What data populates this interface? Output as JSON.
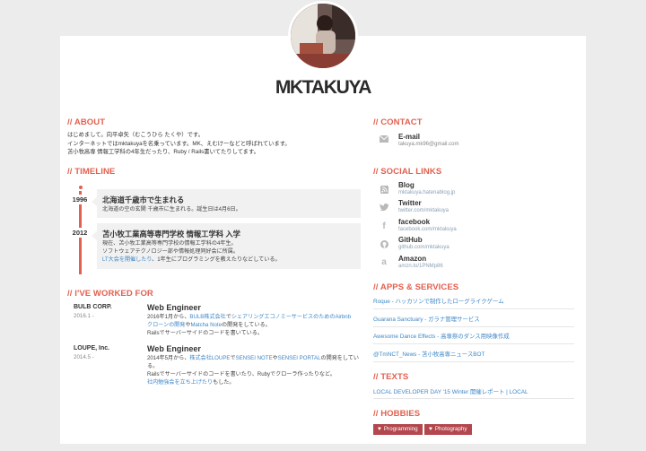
{
  "profile": {
    "name": "MKTAKUYA"
  },
  "about": {
    "title": "// ABOUT",
    "lines": [
      "はじめまして。向平卓矢（むこうひら たくや）です。",
      "インターネットではmktakuyaを名乗っています。MK、えむけーなどと呼ばれています。",
      "苫小牧高専 情報工学科の4年生だったり、Ruby / Rails書いてたりしてます。"
    ]
  },
  "timeline": {
    "title": "// TIMELINE",
    "items": [
      {
        "year": "1996",
        "heading": "北海道千歳市で生まれる",
        "lines": [
          "北海道の空の玄関 千歳市に生まれる。誕生日は4月6日。"
        ]
      },
      {
        "year": "2012",
        "heading": "苫小牧工業高等専門学校 情報工学科 入学",
        "lines": [
          "現在、苫小牧工業高等専門学校の情報工学科の4年生。",
          "ソフトウェアテクノロジー部や情報処理同好会に所属。"
        ],
        "link_text": "LT大会を開催したり",
        "after_link": "、1年生にプログラミングを教えたりなどしている。"
      }
    ]
  },
  "work": {
    "title": "// I'VE WORKED FOR",
    "items": [
      {
        "company": "BULB CORP.",
        "period": "2016.1 -",
        "position": "Web Engineer",
        "line1_pre": "2016年1月から、",
        "line1_link1": "BULB株式会社",
        "line1_mid": "で",
        "line1_link2": "シェアリングエコノミーサービスのためのAirbnb",
        "line2_link1": "クローンの開発",
        "line2_mid": "や",
        "line2_link2": "Matcha Note",
        "line2_post": "の開発をしている。",
        "line3": "Railsでサーバーサイドのコードを書いている。"
      },
      {
        "company": "LOUPE, Inc.",
        "period": "2014.5 -",
        "position": "Web Engineer",
        "line1_pre": "2014年5月から、",
        "line1_link1": "株式会社LOUPE",
        "line1_mid": "で",
        "line1_link2": "SENSEI NOTE",
        "line1_mid2": "や",
        "line1_link3": "SENSEI PORTAL",
        "line1_post": "の開発をしてい",
        "line2": "る。",
        "line3": "Railsでサーバーサイドのコードを書いたり、Rubyでクローラ作ったりなど。",
        "line4_link": "社内勉強会を立ち上げたり",
        "line4_post": "もした。"
      }
    ]
  },
  "contact": {
    "title": "// CONTACT",
    "email_label": "E-mail",
    "email": "takuya.mk96@gmail.com"
  },
  "social": {
    "title": "// SOCIAL LINKS",
    "items": [
      {
        "icon": "rss-icon",
        "name": "Blog",
        "url": "mktakuya.hatenablog.jp"
      },
      {
        "icon": "twitter-icon",
        "name": "Twitter",
        "url": "twitter.com/mktakuya"
      },
      {
        "icon": "facebook-icon",
        "name": "facebook",
        "url": "facebook.com/mktakuya"
      },
      {
        "icon": "github-icon",
        "name": "GitHub",
        "url": "github.com/mktakuya"
      },
      {
        "icon": "amazon-icon",
        "name": "Amazon",
        "url": "amzn.to/1PNMp86"
      }
    ]
  },
  "apps": {
    "title": "// APPS & SERVICES",
    "items": [
      "Roque - ハッカソンで制作したローグライクゲーム",
      "Guarana Sanctuary - ガラナ管理サービス",
      "Awesome Dance Effects - 高専祭のダンス用映像作成",
      "@TmNCT_News - 苫小牧高専ニュースBOT"
    ]
  },
  "texts": {
    "title": "// TEXTS",
    "items": [
      "LOCAL DEVELOPER DAY '15 Winter 開催レポート | LOCAL"
    ]
  },
  "hobbies": {
    "title": "// HOBBIES",
    "items": [
      "Programming",
      "Photography"
    ],
    "icon": "heart-icon",
    "color": "#b3474d"
  },
  "colors": {
    "accent": "#e2604f",
    "link": "#3f87c7",
    "background": "#ececec"
  }
}
